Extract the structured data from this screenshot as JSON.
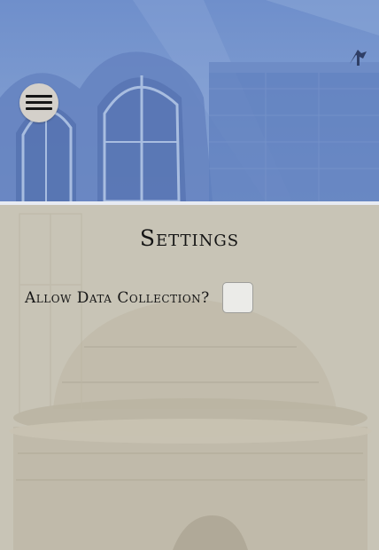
{
  "header": {
    "menu_icon": "hamburger-menu-icon"
  },
  "settings": {
    "title": "Settings",
    "allow_data_collection": {
      "label": "Allow Data Collection?",
      "checked": false
    }
  },
  "colors": {
    "header_tint": "#7b99cf",
    "content_tint": "#c8c4b6",
    "menu_button_bg": "#d4d0ca",
    "checkbox_bg": "#ebebe8",
    "text": "#141414"
  }
}
